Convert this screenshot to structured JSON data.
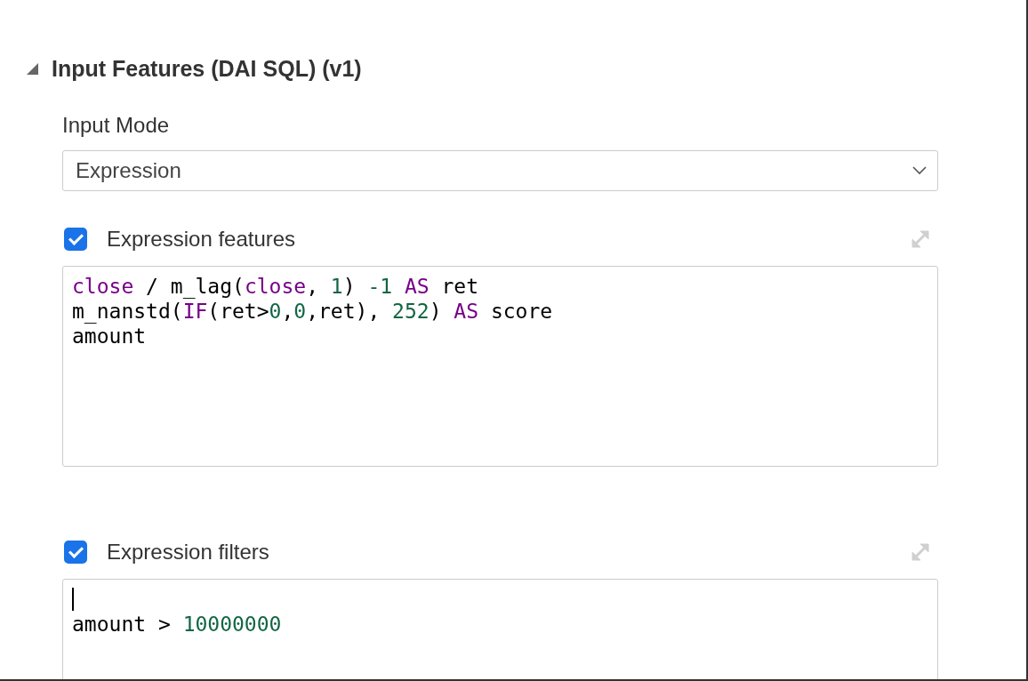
{
  "section": {
    "title": "Input Features (DAI SQL) (v1)",
    "expanded": true
  },
  "input_mode": {
    "label": "Input Mode",
    "value": "Expression"
  },
  "editors": [
    {
      "label": "Expression features",
      "checked": true,
      "lines": [
        {
          "tokens": [
            {
              "text": "close",
              "kind": "keyword"
            },
            {
              "text": " / m_lag(",
              "kind": "plain"
            },
            {
              "text": "close",
              "kind": "keyword"
            },
            {
              "text": ", ",
              "kind": "plain"
            },
            {
              "text": "1",
              "kind": "number"
            },
            {
              "text": ") ",
              "kind": "plain"
            },
            {
              "text": "-1",
              "kind": "number"
            },
            {
              "text": " AS",
              "kind": "keyword"
            },
            {
              "text": " ret",
              "kind": "plain"
            }
          ]
        },
        {
          "tokens": [
            {
              "text": "m_nanstd(",
              "kind": "plain"
            },
            {
              "text": "IF",
              "kind": "keyword"
            },
            {
              "text": "(ret>",
              "kind": "plain"
            },
            {
              "text": "0",
              "kind": "number"
            },
            {
              "text": ",",
              "kind": "plain"
            },
            {
              "text": "0",
              "kind": "number"
            },
            {
              "text": ",ret), ",
              "kind": "plain"
            },
            {
              "text": "252",
              "kind": "number"
            },
            {
              "text": ") ",
              "kind": "plain"
            },
            {
              "text": "AS",
              "kind": "keyword"
            },
            {
              "text": " score",
              "kind": "plain"
            }
          ]
        },
        {
          "tokens": [
            {
              "text": "amount",
              "kind": "plain"
            }
          ]
        }
      ]
    },
    {
      "label": "Expression filters",
      "checked": true,
      "lines": [
        {
          "caret": true
        },
        {
          "tokens": [
            {
              "text": "amount > ",
              "kind": "plain"
            },
            {
              "text": "10000000",
              "kind": "number"
            }
          ]
        }
      ]
    }
  ]
}
